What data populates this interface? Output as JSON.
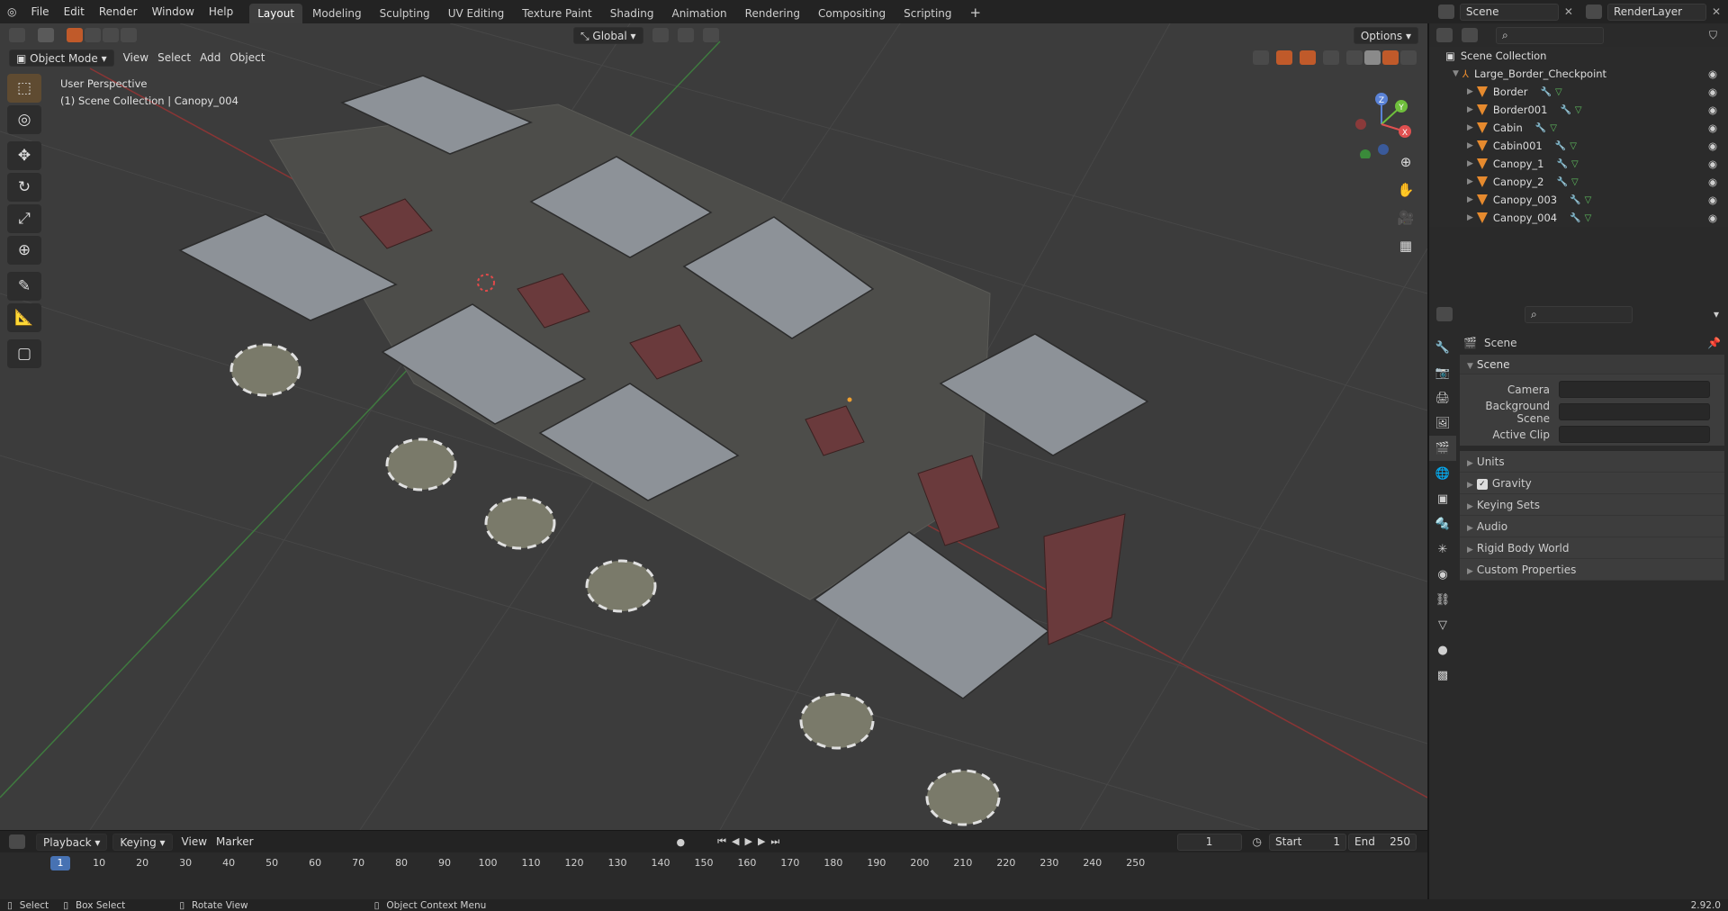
{
  "menu": {
    "items": [
      "File",
      "Edit",
      "Render",
      "Window",
      "Help"
    ]
  },
  "workspaces": [
    "Layout",
    "Modeling",
    "Sculpting",
    "UV Editing",
    "Texture Paint",
    "Shading",
    "Animation",
    "Rendering",
    "Compositing",
    "Scripting"
  ],
  "workspace_add": "+",
  "scene_field": "Scene",
  "renderlayer_field": "RenderLayer",
  "viewport": {
    "mode": "Object Mode",
    "menus": [
      "View",
      "Select",
      "Add",
      "Object"
    ],
    "orientation": "Global",
    "options": "Options",
    "overlay_line1": "User Perspective",
    "overlay_line2": "(1) Scene Collection | Canopy_004"
  },
  "gizmo": {
    "z": "Z",
    "y": "Y",
    "x": "X"
  },
  "timeline": {
    "playback": "Playback",
    "keying": "Keying",
    "view": "View",
    "marker": "Marker",
    "current_frame": "1",
    "start_label": "Start",
    "start_value": "1",
    "end_label": "End",
    "end_value": "250",
    "ticks": [
      "10",
      "20",
      "30",
      "40",
      "50",
      "60",
      "70",
      "80",
      "90",
      "100",
      "110",
      "120",
      "130",
      "140",
      "150",
      "160",
      "170",
      "180",
      "190",
      "200",
      "210",
      "220",
      "230",
      "240",
      "250"
    ],
    "cur_tick": "1"
  },
  "status": {
    "select": "Select",
    "box_select": "Box Select",
    "rotate": "Rotate View",
    "context": "Object Context Menu",
    "version": "2.92.0"
  },
  "outliner": {
    "root": "Scene Collection",
    "collection": "Large_Border_Checkpoint",
    "objects": [
      "Border",
      "Border001",
      "Cabin",
      "Cabin001",
      "Canopy_1",
      "Canopy_2",
      "Canopy_003",
      "Canopy_004"
    ]
  },
  "properties": {
    "header": "Scene",
    "panel": "Scene",
    "camera": "Camera",
    "background_scene": "Background Scene",
    "active_clip": "Active Clip",
    "subpanels": [
      "Units",
      "Gravity",
      "Keying Sets",
      "Audio",
      "Rigid Body World",
      "Custom Properties"
    ]
  },
  "colors": {
    "accent": "#4772b3",
    "active_tool": "#5f4b31",
    "object_orange": "#e68a2e"
  }
}
